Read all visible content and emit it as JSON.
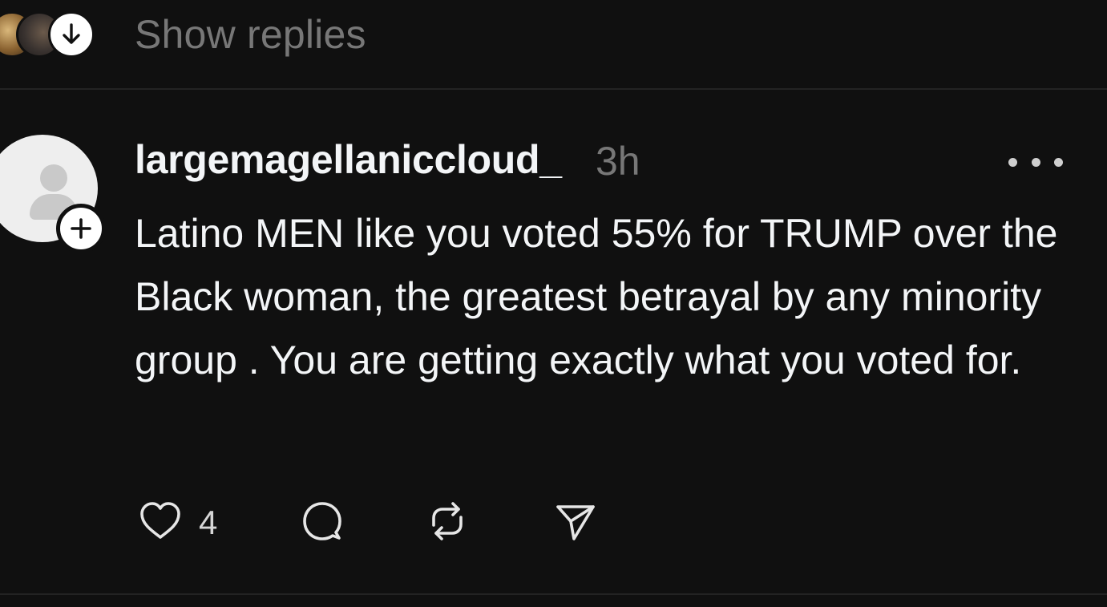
{
  "replies": {
    "label": "Show replies"
  },
  "post": {
    "username": "largemagellaniccloud_",
    "time": "3h",
    "text": "Latino MEN like you voted 55% for TRUMP over the Black woman, the greatest betrayal by any minority group . You are getting exactly what you voted for.",
    "like_count": "4"
  },
  "colors": {
    "background": "#101010",
    "primary_text": "#f3f5f7",
    "secondary_text": "#777777",
    "divider": "#232323"
  },
  "icons": {
    "reply_toggle": "arrow-down-icon",
    "follow": "plus-icon",
    "more": "more-icon",
    "like": "heart-icon",
    "reply": "comment-icon",
    "repost": "repost-icon",
    "share": "send-icon"
  }
}
